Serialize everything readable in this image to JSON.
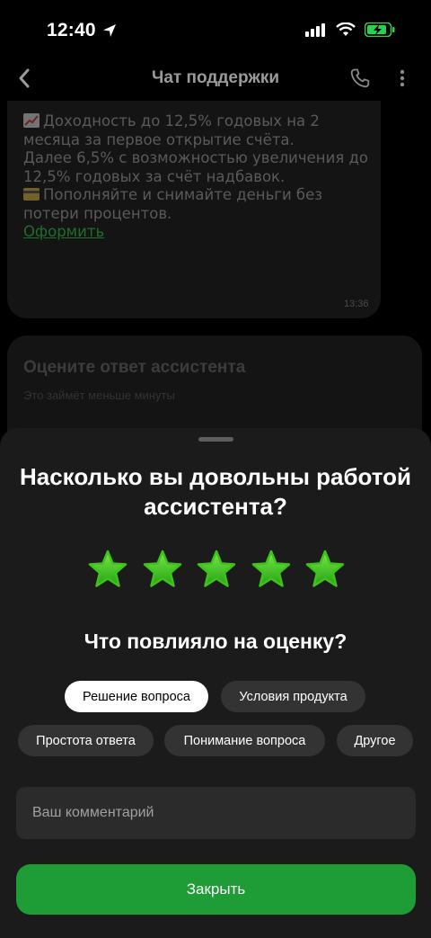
{
  "status_bar": {
    "time": "12:40"
  },
  "header": {
    "title": "Чат поддержки"
  },
  "message": {
    "lines": [
      "Доходность до 12,5% годовых на 2",
      "месяца за первое открытие счёта.",
      "Далее 6,5% с возможностью увеличения до",
      "12,5% годовых за счёт надбавок.",
      "Пополняйте и снимайте деньги без",
      "потери процентов."
    ],
    "link": "Оформить",
    "time": "13:36"
  },
  "rate_card": {
    "title": "Оцените ответ ассистента",
    "subtitle": "Это займёт меньше минуты"
  },
  "sheet": {
    "title_line1": "Насколько вы довольны работой",
    "title_line2": "ассистента?",
    "rating": 5,
    "rating_max": 5,
    "question": "Что повлияло на оценку?",
    "chips": [
      {
        "label": "Решение вопроса",
        "selected": true
      },
      {
        "label": "Условия продукта",
        "selected": false
      },
      {
        "label": "Простота ответа",
        "selected": false
      },
      {
        "label": "Понимание вопроса",
        "selected": false
      },
      {
        "label": "Другое",
        "selected": false
      }
    ],
    "comment_placeholder": "Ваш комментарий",
    "close_label": "Закрыть"
  },
  "icons": {
    "star": "star-icon",
    "back": "chevron-left-icon",
    "phone": "phone-icon",
    "more": "more-vertical-icon"
  },
  "colors": {
    "accent_green": "#1e9c35",
    "star_green": "#3ec21e",
    "link_green": "#1f6e2a"
  }
}
